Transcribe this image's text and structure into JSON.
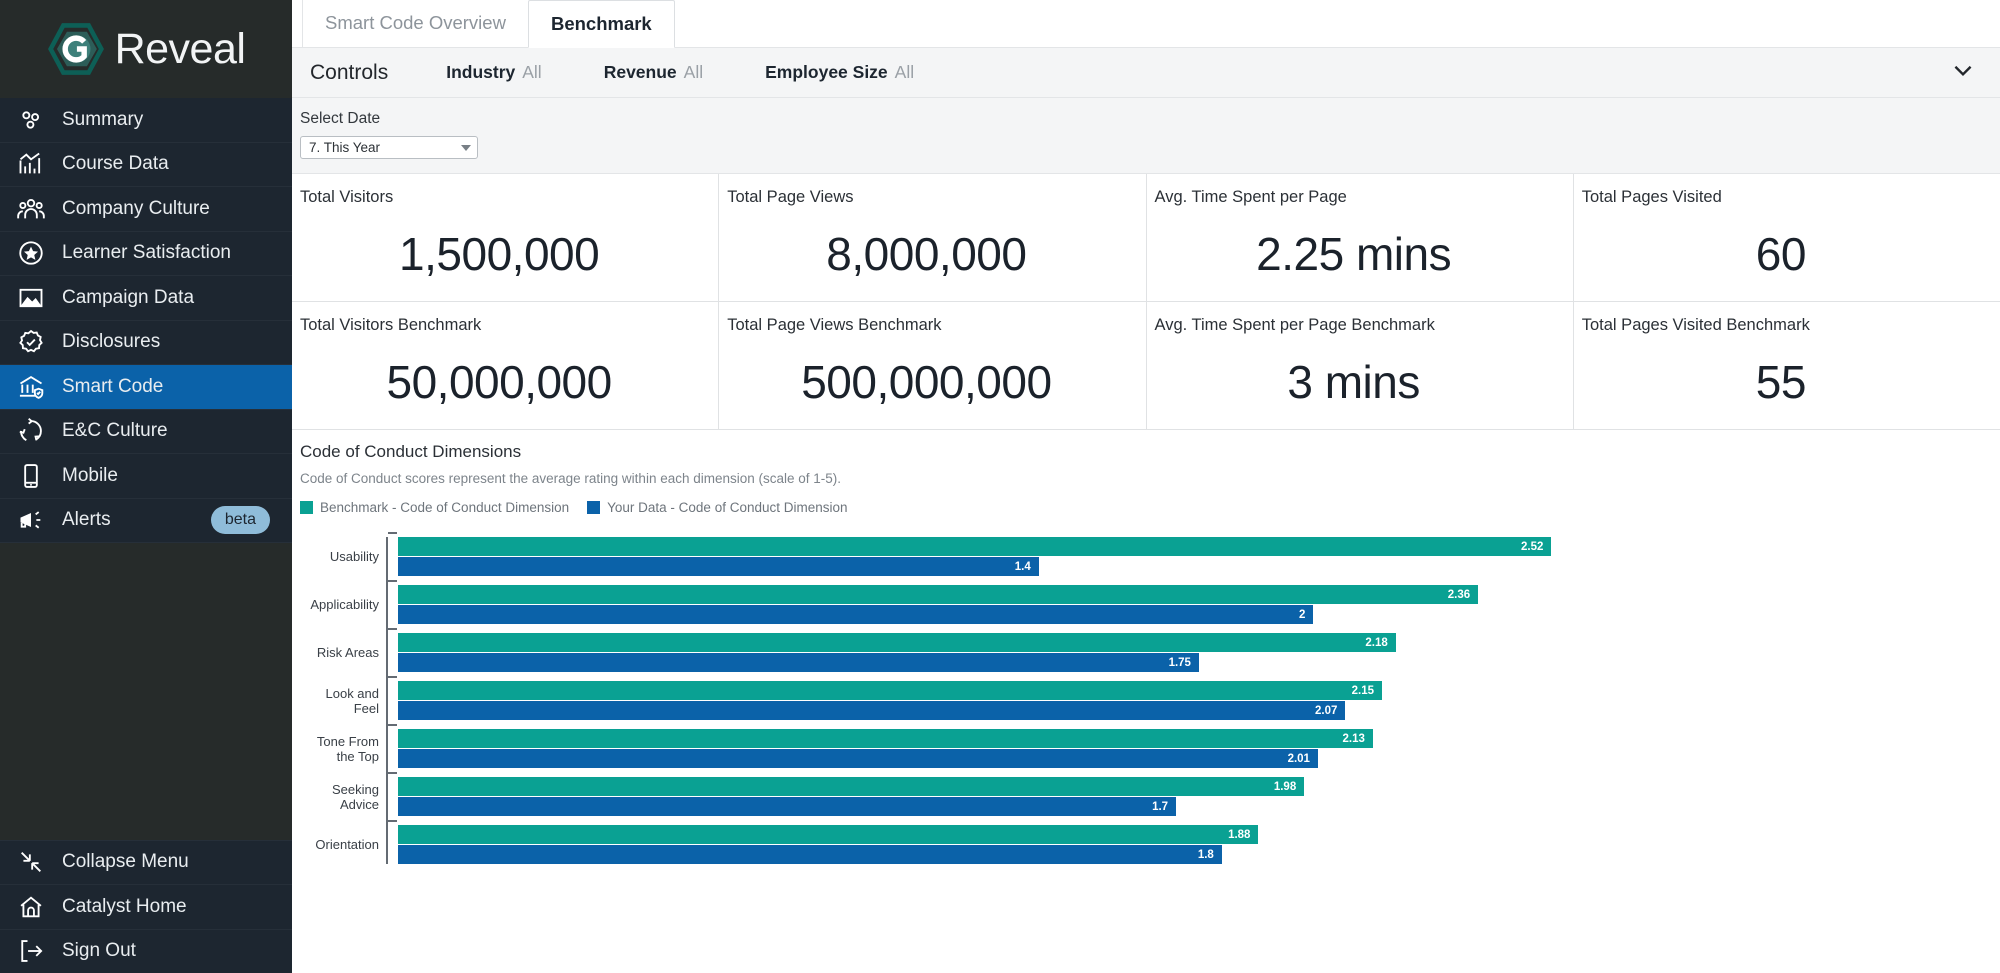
{
  "brand": {
    "name": "Reveal",
    "logo_icon": "hexagon-c-logo",
    "logo_color": "#0d5f56",
    "accent_blue": "#0b62a9",
    "accent_teal": "#0aa193"
  },
  "sidebar": {
    "items": [
      {
        "label": "Summary",
        "icon": "dots-cluster-icon",
        "active": false
      },
      {
        "label": "Course Data",
        "icon": "bar-chart-trend-icon",
        "active": false
      },
      {
        "label": "Company Culture",
        "icon": "people-group-icon",
        "active": false
      },
      {
        "label": "Learner Satisfaction",
        "icon": "star-circle-icon",
        "active": false
      },
      {
        "label": "Campaign Data",
        "icon": "image-mountain-icon",
        "active": false
      },
      {
        "label": "Disclosures",
        "icon": "badge-check-icon",
        "active": false
      },
      {
        "label": "Smart Code",
        "icon": "bank-shield-icon",
        "active": true
      },
      {
        "label": "E&C Culture",
        "icon": "refresh-cycle-icon",
        "active": false
      },
      {
        "label": "Mobile",
        "icon": "mobile-phone-icon",
        "active": false
      },
      {
        "label": "Alerts",
        "icon": "megaphone-icon",
        "active": false,
        "badge": "beta"
      }
    ],
    "bottom_items": [
      {
        "label": "Collapse Menu",
        "icon": "collapse-arrows-icon"
      },
      {
        "label": "Catalyst Home",
        "icon": "home-icon"
      },
      {
        "label": "Sign Out",
        "icon": "sign-out-icon"
      }
    ]
  },
  "tabs": [
    {
      "label": "Smart Code Overview",
      "active": false
    },
    {
      "label": "Benchmark",
      "active": true
    }
  ],
  "controls": {
    "title": "Controls",
    "filters": [
      {
        "name": "Industry",
        "value": "All"
      },
      {
        "name": "Revenue",
        "value": "All"
      },
      {
        "name": "Employee Size",
        "value": "All"
      }
    ],
    "expand_icon": "chevron-down-icon"
  },
  "date_filter": {
    "label": "Select Date",
    "selected": "7. This Year"
  },
  "kpis": [
    [
      {
        "label": "Total Visitors",
        "value": "1,500,000"
      },
      {
        "label": "Total Page Views",
        "value": "8,000,000"
      },
      {
        "label": "Avg. Time Spent per Page",
        "value": "2.25 mins"
      },
      {
        "label": "Total Pages Visited",
        "value": "60"
      }
    ],
    [
      {
        "label": "Total Visitors Benchmark",
        "value": "50,000,000"
      },
      {
        "label": "Total Page Views Benchmark",
        "value": "500,000,000"
      },
      {
        "label": "Avg. Time Spent per Page Benchmark",
        "value": "3 mins"
      },
      {
        "label": "Total Pages Visited Benchmark",
        "value": "55"
      }
    ]
  ],
  "chart_section": {
    "title": "Code of Conduct Dimensions",
    "subtitle": "Code of Conduct scores represent the average rating within each dimension (scale of 1-5)."
  },
  "chart_data": {
    "type": "bar",
    "orientation": "horizontal",
    "title": "Code of Conduct Dimensions",
    "subtitle": "Code of Conduct scores represent the average rating within each dimension (scale of 1-5).",
    "xlabel": "",
    "ylabel": "",
    "xlim": [
      0,
      2.6
    ],
    "grid": false,
    "legend_position": "top-left",
    "categories": [
      "Usability",
      "Applicability",
      "Risk Areas",
      "Look and Feel",
      "Tone From the Top",
      "Seeking Advice",
      "Orientation"
    ],
    "series": [
      {
        "name": "Benchmark - Code of Conduct Dimension",
        "color": "#0aa193",
        "values": [
          2.52,
          2.36,
          2.18,
          2.15,
          2.13,
          1.98,
          1.88
        ]
      },
      {
        "name": "Your Data - Code of Conduct Dimension",
        "color": "#0b62a9",
        "values": [
          1.4,
          2,
          1.75,
          2.07,
          2.01,
          1.7,
          1.8
        ]
      }
    ]
  }
}
